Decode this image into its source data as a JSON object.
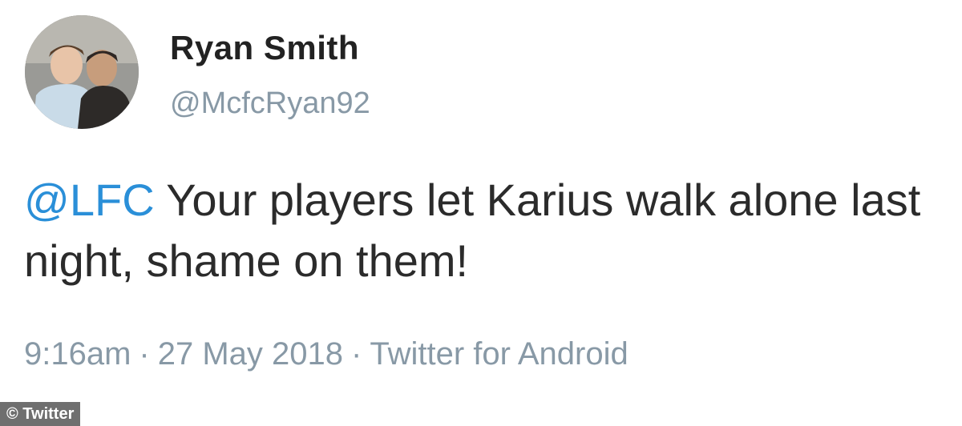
{
  "tweet": {
    "user": {
      "display_name": "Ryan Smith",
      "handle": "@McfcRyan92"
    },
    "text": {
      "mention": "@LFC",
      "body": " Your players let Karius walk alone last night, shame on them!"
    },
    "meta": {
      "time": "9:16am",
      "separator": "·",
      "date": "27 May 2018",
      "source": "Twitter for Android"
    }
  },
  "credit": {
    "label": "© Twitter"
  },
  "colors": {
    "mention": "#2a8fd8",
    "muted": "#8899a6",
    "text": "#2b2b2b"
  }
}
